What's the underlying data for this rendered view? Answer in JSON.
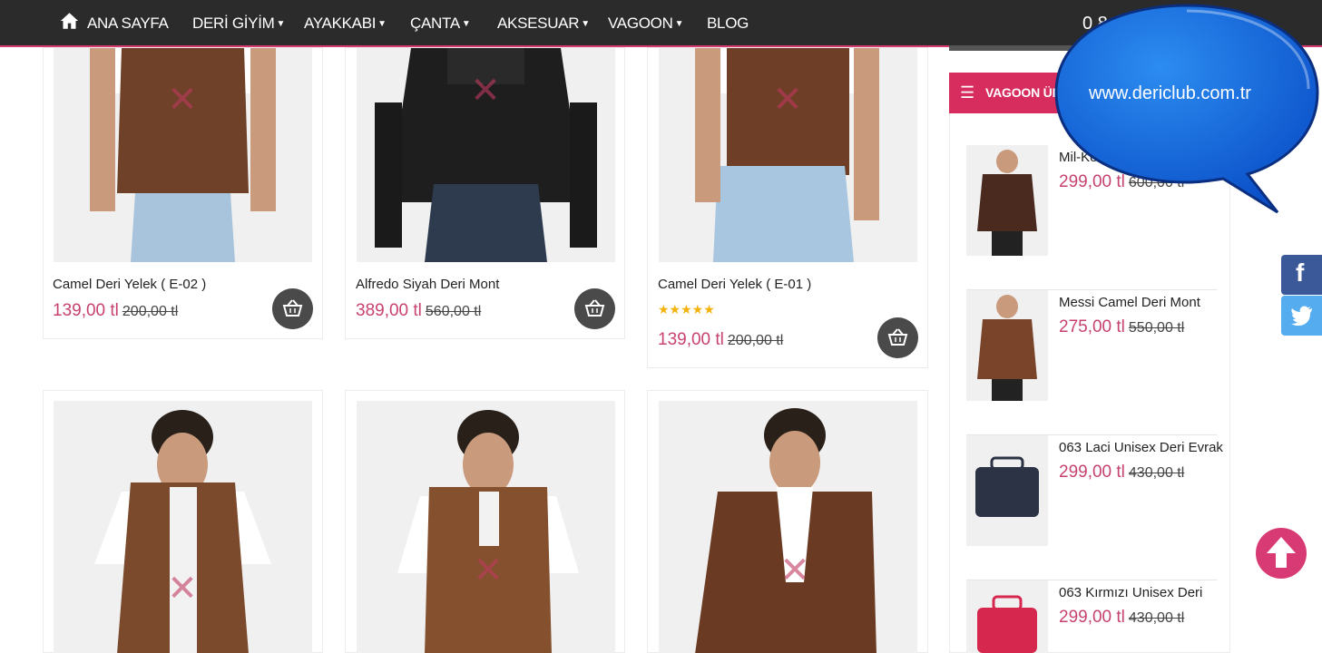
{
  "nav": {
    "items": [
      "ANA SAYFA",
      "DERİ GİYİM",
      "AYAKKABI",
      "ÇANTA",
      "AKSESUAR",
      "VAGOON",
      "BLOG"
    ],
    "cart_total_partial": "0 8"
  },
  "products": [
    {
      "name": "Camel Deri Yelek ( E-02 )",
      "price": "139,00 tl",
      "old_price": "200,00 tl"
    },
    {
      "name": "Alfredo Siyah Deri Mont",
      "price": "389,00 tl",
      "old_price": "560,00 tl"
    },
    {
      "name": "Camel Deri Yelek ( E-01 )",
      "price": "139,00 tl",
      "old_price": "200,00 tl",
      "stars": "★★★★★"
    }
  ],
  "sidebar": {
    "title": "VAGOON ÜR",
    "items": [
      {
        "name": "Mil-Ke",
        "price": "299,00 tl",
        "old_price": "600,00 tl"
      },
      {
        "name": "Messi Camel Deri Mont",
        "price": "275,00 tl",
        "old_price": "550,00 tl"
      },
      {
        "name": "063 Laci Unisex Deri Evrak",
        "price": "299,00 tl",
        "old_price": "430,00 tl"
      },
      {
        "name": "063 Kırmızı Unisex Deri",
        "price": "299,00 tl",
        "old_price": "430,00 tl"
      }
    ]
  },
  "bubble": {
    "text": "www.dericlub.com.tr"
  },
  "social": {
    "facebook": "f"
  },
  "colors": {
    "accent": "#d62c5e",
    "price": "#c8426f",
    "nav_bg": "#2b2b2b"
  }
}
